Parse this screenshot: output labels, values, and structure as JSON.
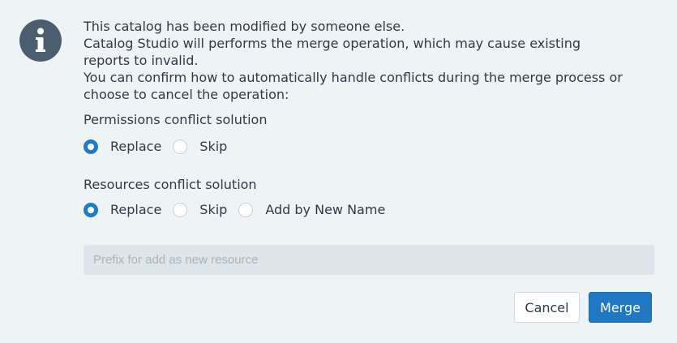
{
  "dialog": {
    "message_lines": [
      "This catalog has been modified by someone else.",
      "Catalog Studio will performs the merge operation, which may cause existing",
      "reports to invalid.",
      "You can confirm how to automatically handle conflicts during the merge process or",
      "choose to cancel the operation:"
    ],
    "icon": "info-icon",
    "colors": {
      "icon_bg": "#4b5e70",
      "accent": "#1f78c1",
      "background": "#eef3f6"
    }
  },
  "permissions": {
    "label": "Permissions conflict solution",
    "options": [
      "Replace",
      "Skip"
    ],
    "selected": "Replace"
  },
  "resources": {
    "label": "Resources conflict solution",
    "options": [
      "Replace",
      "Skip",
      "Add by New Name"
    ],
    "selected": "Replace"
  },
  "prefix_input": {
    "placeholder": "Prefix for add as new resource",
    "value": ""
  },
  "buttons": {
    "cancel_label": "Cancel",
    "merge_label": "Merge"
  }
}
